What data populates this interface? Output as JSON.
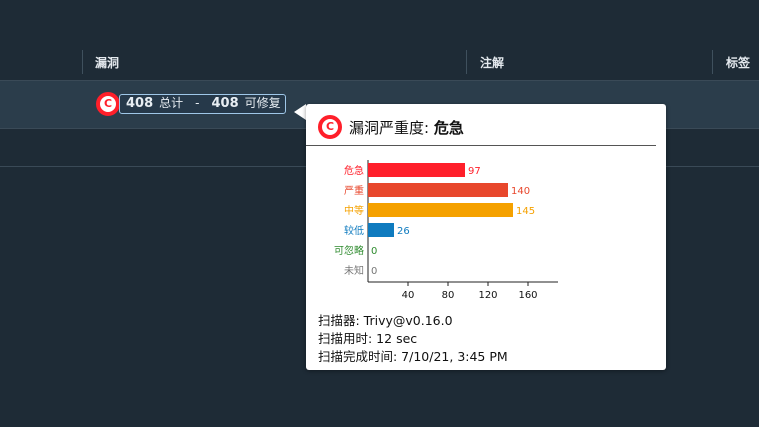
{
  "table": {
    "columns": [
      "漏洞",
      "注解",
      "标签"
    ]
  },
  "row": {
    "severity_badge": "C",
    "total_count": "408",
    "total_label": "总计",
    "separator": "-",
    "fixable_count": "408",
    "fixable_label": "可修复"
  },
  "popover": {
    "badge": "C",
    "title_prefix": "漏洞严重度: ",
    "title_level": "危急",
    "scanner_line": "扫描器: Trivy@v0.16.0",
    "duration_line": "扫描用时: 12 sec",
    "completed_line": "扫描完成时间: 7/10/21, 3:45 PM"
  },
  "colors": {
    "critical": "#ff1f2a",
    "high": "#e8472c",
    "medium": "#f5a100",
    "low": "#0f7bbf",
    "negligible": "#2e8b2e",
    "unknown": "#777777"
  },
  "chart_data": {
    "type": "bar",
    "orientation": "horizontal",
    "categories": [
      "危急",
      "严重",
      "中等",
      "较低",
      "可忽略",
      "未知"
    ],
    "values": [
      97,
      140,
      145,
      26,
      0,
      0
    ],
    "colors": [
      "#ff1f2a",
      "#e8472c",
      "#f5a100",
      "#0f7bbf",
      "#2e8b2e",
      "#777777"
    ],
    "xticks": [
      40,
      80,
      120,
      160
    ],
    "xlim": [
      0,
      190
    ],
    "grid": false,
    "title": "",
    "xlabel": "",
    "ylabel": ""
  }
}
